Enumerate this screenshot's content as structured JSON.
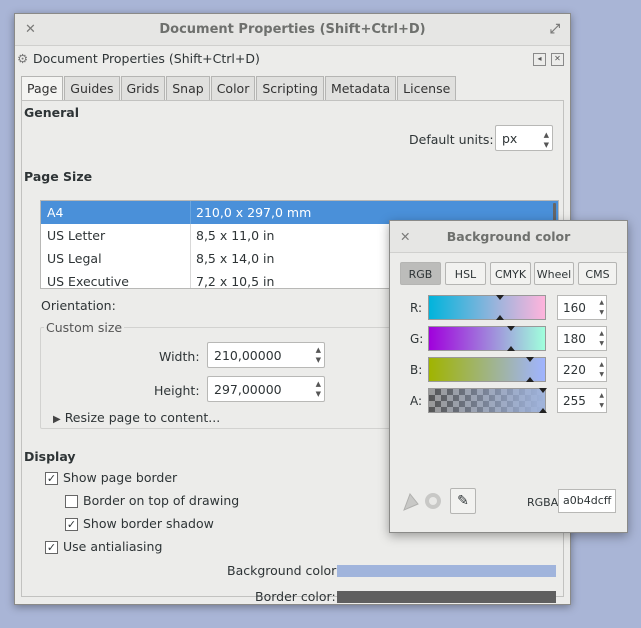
{
  "main_window": {
    "title": "Document Properties (Shift+Ctrl+D)",
    "dock_title": "Document Properties (Shift+Ctrl+D)",
    "tabs": [
      "Page",
      "Guides",
      "Grids",
      "Snap",
      "Color",
      "Scripting",
      "Metadata",
      "License"
    ],
    "active_tab": "Page",
    "general": {
      "heading": "General",
      "default_units_label": "Default units:",
      "default_units_value": "px"
    },
    "page_size": {
      "heading": "Page Size",
      "rows": [
        {
          "name": "A4",
          "size": "210,0 x 297,0 mm",
          "selected": true
        },
        {
          "name": "US Letter",
          "size": "8,5 x 11,0 in"
        },
        {
          "name": "US Legal",
          "size": "8,5 x 14,0 in"
        },
        {
          "name": "US Executive",
          "size": "7,2 x 10,5 in"
        }
      ],
      "orientation_label": "Orientation:",
      "custom_size_label": "Custom size",
      "width_label": "Width:",
      "width_value": "210,00000",
      "height_label": "Height:",
      "height_value": "297,00000",
      "resize_label": "Resize page to content..."
    },
    "display": {
      "heading": "Display",
      "show_page_border": "Show page border",
      "border_on_top": "Border on top of drawing",
      "show_border_shadow": "Show border shadow",
      "use_antialiasing": "Use antialiasing",
      "background_color_label": "Background color:",
      "border_color_label": "Border color:",
      "background_color": "#a0b4dc",
      "border_color": "#5f5f5f"
    }
  },
  "color_dialog": {
    "title": "Background color",
    "modes": [
      "RGB",
      "HSL",
      "CMYK",
      "Wheel",
      "CMS"
    ],
    "active_mode": "RGB",
    "channels": [
      {
        "label": "R:",
        "value": "160"
      },
      {
        "label": "G:",
        "value": "180"
      },
      {
        "label": "B:",
        "value": "220"
      },
      {
        "label": "A:",
        "value": "255"
      }
    ],
    "rgba_label": "RGBA:",
    "rgba_value": "a0b4dcff"
  }
}
